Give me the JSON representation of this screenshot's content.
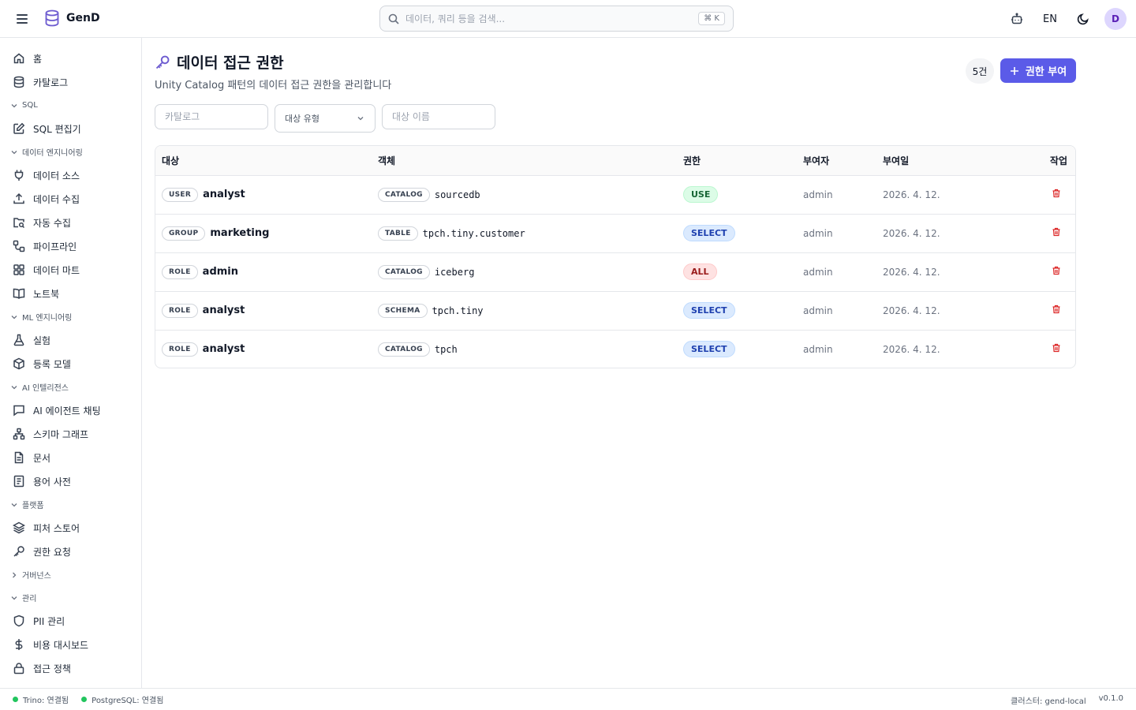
{
  "app": {
    "name": "GenD"
  },
  "search": {
    "placeholder": "데이터, 쿼리 등을 검색...",
    "shortcut": "⌘ K"
  },
  "header": {
    "language": "EN",
    "avatar_initial": "D"
  },
  "sidebar": {
    "items_top": [
      {
        "label": "홈",
        "icon": "home-icon"
      },
      {
        "label": "카탈로그",
        "icon": "database-icon"
      }
    ],
    "sections": [
      {
        "title": "SQL",
        "expanded": true,
        "items": [
          {
            "label": "SQL 편집기",
            "icon": "edit-icon"
          }
        ]
      },
      {
        "title": "데이터 엔지니어링",
        "expanded": true,
        "items": [
          {
            "label": "데이터 소스",
            "icon": "plug-icon"
          },
          {
            "label": "데이터 수집",
            "icon": "upload-icon"
          },
          {
            "label": "자동 수집",
            "icon": "folder-search-icon"
          },
          {
            "label": "파이프라인",
            "icon": "workflow-icon"
          },
          {
            "label": "데이터 마트",
            "icon": "grid-icon"
          },
          {
            "label": "노트북",
            "icon": "book-icon"
          }
        ]
      },
      {
        "title": "ML 엔지니어링",
        "expanded": true,
        "items": [
          {
            "label": "실험",
            "icon": "flask-icon"
          },
          {
            "label": "등록 모델",
            "icon": "package-icon"
          }
        ]
      },
      {
        "title": "AI 인텔리전스",
        "expanded": true,
        "items": [
          {
            "label": "AI 에이전트 채팅",
            "icon": "chat-icon"
          },
          {
            "label": "스키마 그래프",
            "icon": "network-icon"
          },
          {
            "label": "문서",
            "icon": "document-icon"
          },
          {
            "label": "용어 사전",
            "icon": "glossary-icon"
          }
        ]
      },
      {
        "title": "플랫폼",
        "expanded": true,
        "items": [
          {
            "label": "피처 스토어",
            "icon": "layers-icon"
          },
          {
            "label": "권한 요청",
            "icon": "key-icon"
          }
        ]
      },
      {
        "title": "거버넌스",
        "expanded": false,
        "items": []
      },
      {
        "title": "관리",
        "expanded": true,
        "items": [
          {
            "label": "PII 관리",
            "icon": "shield-icon"
          },
          {
            "label": "비용 대시보드",
            "icon": "dollar-icon"
          },
          {
            "label": "접근 정책",
            "icon": "lock-icon"
          }
        ]
      }
    ]
  },
  "page": {
    "title": "데이터 접근 권한",
    "subtitle": "Unity Catalog 패턴의 데이터 접근 권한을 관리합니다",
    "count": "5건",
    "grant_button": "권한 부여"
  },
  "filters": {
    "catalog_placeholder": "카탈로그",
    "type_placeholder": "대상 유형",
    "name_placeholder": "대상 이름"
  },
  "table": {
    "columns": [
      "대상",
      "객체",
      "권한",
      "부여자",
      "부여일",
      "작업"
    ],
    "rows": [
      {
        "subject_type": "USER",
        "subject": "analyst",
        "object_type": "CATALOG",
        "object": "sourcedb",
        "permission": "USE",
        "granted_by": "admin",
        "granted_at": "2026. 4. 12."
      },
      {
        "subject_type": "GROUP",
        "subject": "marketing",
        "object_type": "TABLE",
        "object": "tpch.tiny.customer",
        "permission": "SELECT",
        "granted_by": "admin",
        "granted_at": "2026. 4. 12."
      },
      {
        "subject_type": "ROLE",
        "subject": "admin",
        "object_type": "CATALOG",
        "object": "iceberg",
        "permission": "ALL",
        "granted_by": "admin",
        "granted_at": "2026. 4. 12."
      },
      {
        "subject_type": "ROLE",
        "subject": "analyst",
        "object_type": "SCHEMA",
        "object": "tpch.tiny",
        "permission": "SELECT",
        "granted_by": "admin",
        "granted_at": "2026. 4. 12."
      },
      {
        "subject_type": "ROLE",
        "subject": "analyst",
        "object_type": "CATALOG",
        "object": "tpch",
        "permission": "SELECT",
        "granted_by": "admin",
        "granted_at": "2026. 4. 12."
      }
    ]
  },
  "footer": {
    "trino": "Trino: 연결됨",
    "postgres": "PostgreSQL: 연결됨",
    "cluster": "클러스터: gend-local",
    "version": "v0.1.0"
  },
  "colors": {
    "accent": "#5b5be8",
    "status_ok": "#22c55e",
    "danger": "#dc2626"
  }
}
